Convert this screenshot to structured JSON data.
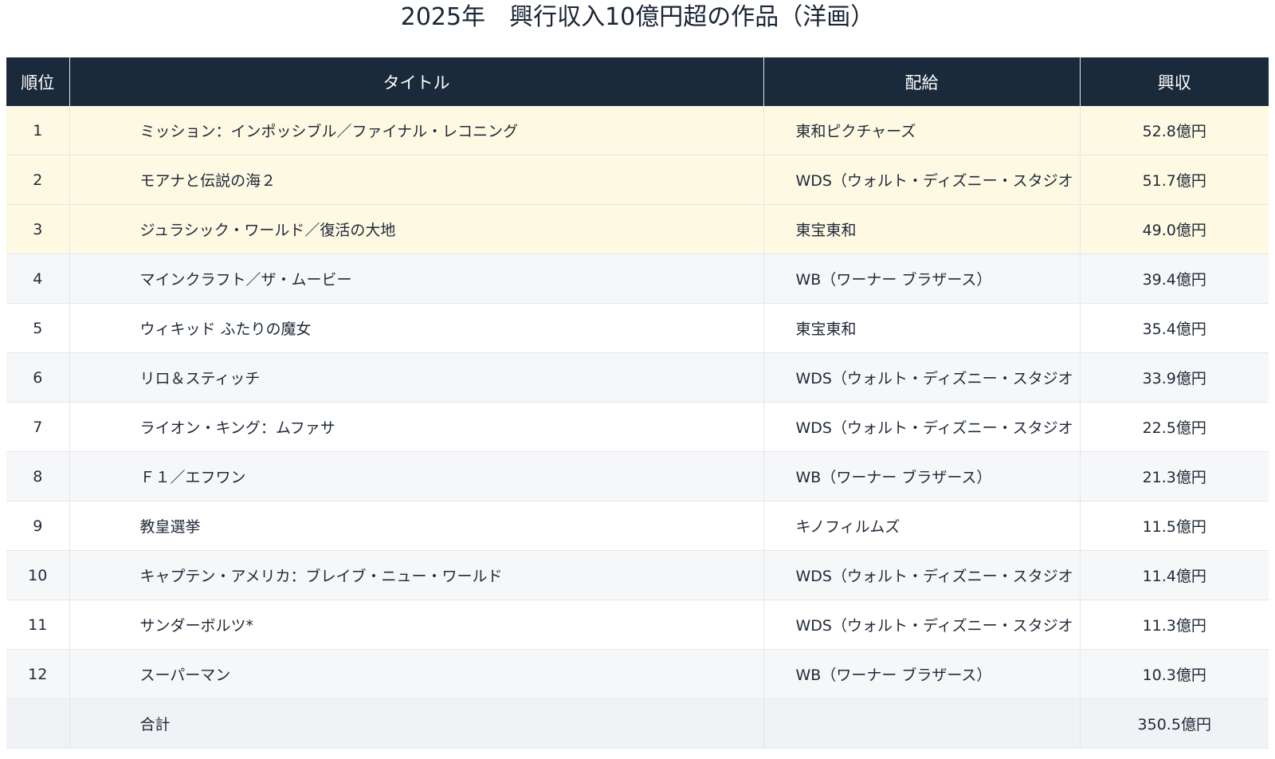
{
  "title": "2025年　興行収入10億円超の作品（洋画）",
  "table": {
    "headers": {
      "rank": "順位",
      "title": "タイトル",
      "distributor": "配給",
      "revenue": "興収"
    },
    "rows": [
      {
        "rank": "1",
        "title": "ミッション：インポッシブル／ファイナル・レコニング",
        "distributor": "東和ピクチャーズ",
        "revenue": "52.8億円"
      },
      {
        "rank": "2",
        "title": "モアナと伝説の海２",
        "distributor": "WDS（ウォルト・ディズニー・スタジオ",
        "revenue": "51.7億円"
      },
      {
        "rank": "3",
        "title": "ジュラシック・ワールド／復活の大地",
        "distributor": "東宝東和",
        "revenue": "49.0億円"
      },
      {
        "rank": "4",
        "title": "マインクラフト／ザ・ムービー",
        "distributor": "WB（ワーナー ブラザース）",
        "revenue": "39.4億円"
      },
      {
        "rank": "5",
        "title": "ウィキッド ふたりの魔女",
        "distributor": "東宝東和",
        "revenue": "35.4億円"
      },
      {
        "rank": "6",
        "title": "リロ＆スティッチ",
        "distributor": "WDS（ウォルト・ディズニー・スタジオ",
        "revenue": "33.9億円"
      },
      {
        "rank": "7",
        "title": "ライオン・キング：ムファサ",
        "distributor": "WDS（ウォルト・ディズニー・スタジオ",
        "revenue": "22.5億円"
      },
      {
        "rank": "8",
        "title": "Ｆ１／エフワン",
        "distributor": "WB（ワーナー ブラザース）",
        "revenue": "21.3億円"
      },
      {
        "rank": "9",
        "title": "教皇選挙",
        "distributor": "キノフィルムズ",
        "revenue": "11.5億円"
      },
      {
        "rank": "10",
        "title": "キャプテン・アメリカ：ブレイブ・ニュー・ワールド",
        "distributor": "WDS（ウォルト・ディズニー・スタジオ",
        "revenue": "11.4億円"
      },
      {
        "rank": "11",
        "title": "サンダーボルツ*",
        "distributor": "WDS（ウォルト・ディズニー・スタジオ",
        "revenue": "11.3億円"
      },
      {
        "rank": "12",
        "title": "スーパーマン",
        "distributor": "WB（ワーナー ブラザース）",
        "revenue": "10.3億円"
      }
    ],
    "total": {
      "rank": "",
      "title": "合計",
      "distributor": "",
      "revenue": "350.5億円"
    }
  },
  "colors": {
    "header_bg": "#1b2a3b",
    "top3_bg": "#fef9e3",
    "alt_row_bg": "#f6f7f9",
    "total_bg": "#f0f2f5"
  }
}
